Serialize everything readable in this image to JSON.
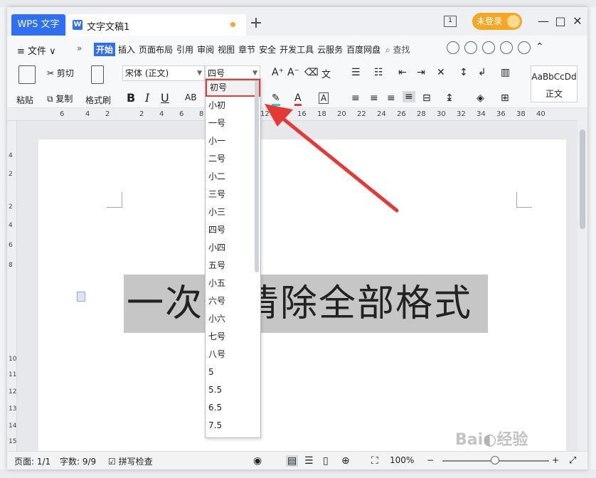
{
  "titlebar": {
    "app_tab": "WPS 文字",
    "doc_tab": "文字文稿1",
    "new_tab": "+",
    "page_indicator": "1",
    "login": "未登录",
    "minimize": "—",
    "maximize": "□",
    "close": "✕"
  },
  "menubar": {
    "file": "≡ 文件 ∨",
    "more": "»",
    "items": [
      "开始",
      "插入",
      "页面布局",
      "引用",
      "审阅",
      "视图",
      "章节",
      "安全",
      "开发工具",
      "云服务",
      "百度网盘"
    ],
    "search": "查找"
  },
  "ribbon": {
    "paste": "粘贴",
    "cut": "剪切",
    "copy": "复制",
    "format_painter": "格式刷",
    "font_name": "宋体 (正文)",
    "font_size": "四号",
    "bold": "B",
    "italic": "I",
    "underline": "U",
    "style_sample": "AaBbCcDd",
    "style_name": "正文"
  },
  "ruler": {
    "h_ticks": [
      "6",
      "4",
      "2",
      "2",
      "4",
      "6",
      "8",
      "10",
      "12",
      "14",
      "16",
      "18",
      "20",
      "22",
      "24",
      "26",
      "28",
      "30",
      "32",
      "34",
      "36",
      "38",
      "40"
    ],
    "v_ticks": [
      "4",
      "2",
      "2",
      "4",
      "6",
      "8",
      "10",
      "11",
      "12",
      "13",
      "14",
      "15"
    ]
  },
  "document": {
    "selected_text": "一次性清除全部格式"
  },
  "font_size_dropdown": {
    "items": [
      "初号",
      "小初",
      "一号",
      "小一",
      "二号",
      "小二",
      "三号",
      "小三",
      "四号",
      "小四",
      "五号",
      "小五",
      "六号",
      "小六",
      "七号",
      "八号",
      "5",
      "5.5",
      "6.5",
      "7.5"
    ],
    "highlighted": "初号",
    "highlight_color": "#e53935"
  },
  "statusbar": {
    "page": "页面: 1/1",
    "words": "字数: 9/9",
    "spellcheck": "拼写检查",
    "zoom": "100%",
    "zoom_minus": "−",
    "zoom_plus": "+"
  },
  "colors": {
    "accent": "#2f6ff2",
    "login": "#f5a623",
    "annotation": "#e53935"
  }
}
